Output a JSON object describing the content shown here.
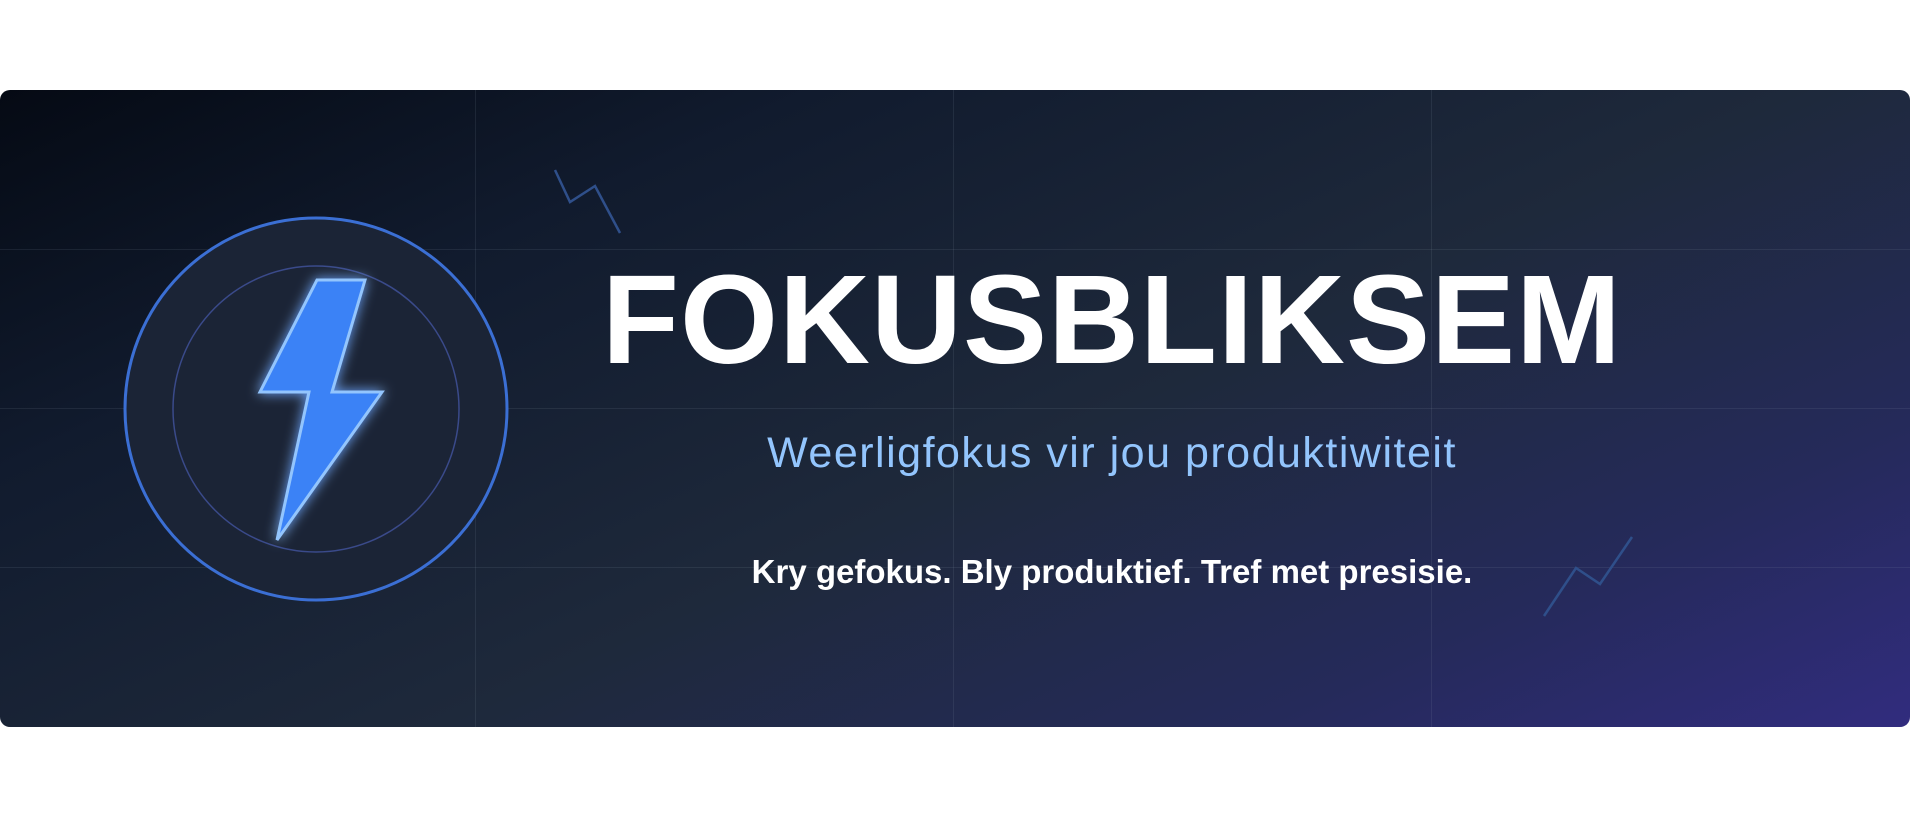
{
  "banner": {
    "title": "FOKUSBLIKSEM",
    "subtitle": "Weerligfokus vir jou produktiwiteit",
    "tagline": "Kry gefokus. Bly produktief. Tref met presisie."
  },
  "icons": {
    "emblem": "lightning-bolt-icon",
    "decorations": "zigzag-lightning-icon"
  },
  "colors": {
    "background_start": "#050a14",
    "background_end": "#312c7e",
    "accent_blue": "#3b82f6",
    "ring_blue": "#3b6fd4",
    "subtitle_blue": "#93c5fd",
    "text_white": "#ffffff"
  }
}
